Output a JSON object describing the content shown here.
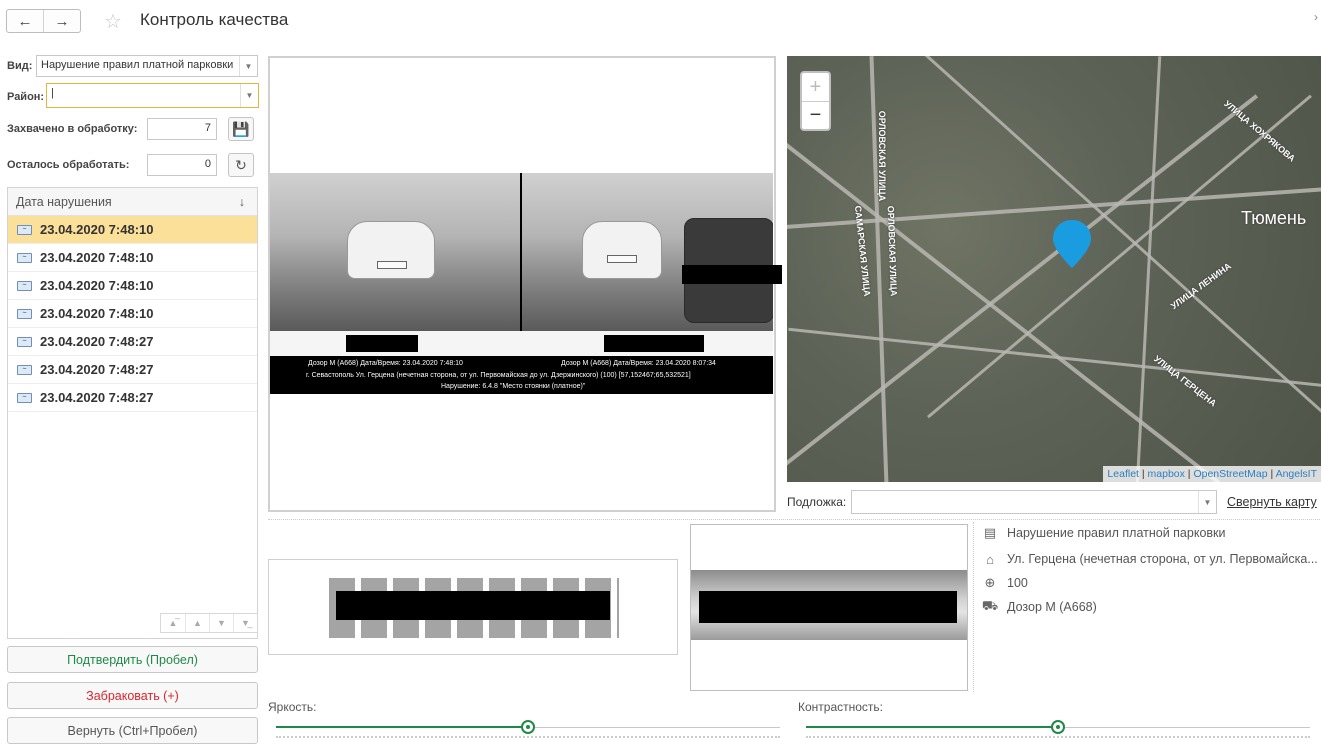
{
  "header": {
    "back_icon": "arrow-left-icon",
    "forward_icon": "arrow-right-icon",
    "favorite_icon": "star-icon",
    "title": "Контроль качества",
    "more_icon": "chevron-right-icon"
  },
  "filters": {
    "kind_label": "Вид:",
    "kind_value": "Нарушение правил платной парковки",
    "district_label": "Район:",
    "district_value": "|",
    "captured_label": "Захвачено в обработку:",
    "captured_value": "7",
    "remaining_label": "Осталось обработать:",
    "remaining_value": "0"
  },
  "list": {
    "header": "Дата нарушения",
    "sort_icon": "sort-down-icon",
    "rows": [
      "23.04.2020 7:48:10",
      "23.04.2020 7:48:10",
      "23.04.2020 7:48:10",
      "23.04.2020 7:48:10",
      "23.04.2020 7:48:27",
      "23.04.2020 7:48:27",
      "23.04.2020 7:48:27"
    ],
    "selected_index": 0
  },
  "actions": {
    "confirm": "Подтвердить (Пробел)",
    "reject": "Забраковать (+)",
    "return": "Вернуть (Ctrl+Пробел)"
  },
  "photo": {
    "cap_left": "Дозор М (А668) Дата/Время: 23.04.2020 7:48:10",
    "cap_right": "Дозор М (А668) Дата/Время: 23.04.2020 8:07:34",
    "cap_address": "г. Севастополь Ул. Герцена (нечетная сторона, от ул. Первомайская до ул. Дзержинского)   (100) [57,152467;65,532521]",
    "cap_violation": "Нарушение: 6.4.8 \"Место стоянки (платное)\""
  },
  "map": {
    "zoom_in": "+",
    "zoom_out": "−",
    "city": "Тюмень",
    "streets": [
      "ОРЛОВСКАЯ УЛИЦА",
      "САМАРСКАЯ УЛИЦА",
      "ОРЛОВСКАЯ УЛИЦА",
      "УЛИЦА ХОХРЯКОВА",
      "УЛИЦА ЛЕНИНА",
      "УЛИЦА ГЕРЦЕНА"
    ],
    "attribution": [
      "Leaflet",
      "mapbox",
      "OpenStreetMap",
      "AngelsIT"
    ],
    "basemap_label": "Подложка:",
    "basemap_value": "",
    "collapse_link": "Свернуть карту",
    "marker_color": "#1a9ce0"
  },
  "info": {
    "type": "Нарушение правил платной парковки",
    "address": "Ул. Герцена (нечетная сторона, от ул. Первомайска...",
    "zone": "100",
    "device": "Дозор М (А668)"
  },
  "adjust": {
    "brightness_label": "Яркость:",
    "brightness_value": 0.5,
    "contrast_label": "Контрастность:",
    "contrast_value": 0.5
  },
  "colors": {
    "accent_green": "#1f8a48",
    "reject_red": "#d9262c",
    "selected_row": "#fbe09a",
    "focus_border": "#e5b53b"
  }
}
